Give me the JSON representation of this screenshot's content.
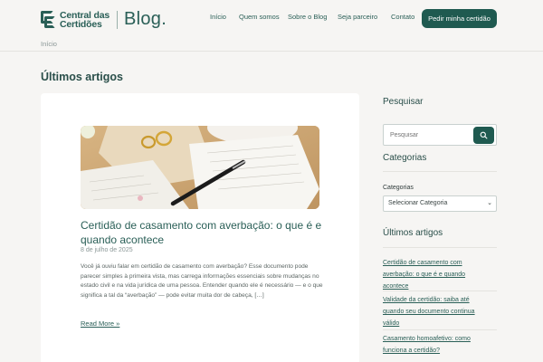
{
  "header": {
    "logo_line1": "Central das",
    "logo_line2": "Certidões",
    "logo_blog": "Blog.",
    "nav": [
      "Início",
      "Quem somos",
      "Sobre o Blog",
      "Seja parceiro",
      "Contato"
    ],
    "cta": "Pedir minha certidão"
  },
  "breadcrumb": "Início",
  "page_title": "Últimos artigos",
  "article": {
    "title": "Certidão de casamento com averbação: o que é e quando acontece",
    "date": "8 de julho de 2025",
    "excerpt": "Você já ouviu falar em certidão de casamento com averbação? Esse documento pode parecer simples à primeira vista, mas carrega informações essenciais sobre mudanças no estado civil e na vida jurídica de uma pessoa. Entender quando ele é necessário — e o que significa a tal da “averbação” — pode evitar muita dor de cabeça, […]",
    "read_more": "Read More »"
  },
  "sidebar": {
    "search_heading": "Pesquisar",
    "search_placeholder": "Pesquisar",
    "categories_heading": "Categorias",
    "categories_label": "Categorias",
    "categories_select": "Selecionar Categoria",
    "recent_heading": "Últimos artigos",
    "recent_links": [
      "Certidão de casamento com averbação: o que é e quando acontece",
      "Validade da certidão: saiba até quando seu documento continua válido",
      "Casamento homoafetivo: como funciona a certidão?"
    ]
  },
  "colors": {
    "brand": "#1f5a50",
    "text_link": "#2a5f57",
    "background": "#f6f5f3"
  }
}
